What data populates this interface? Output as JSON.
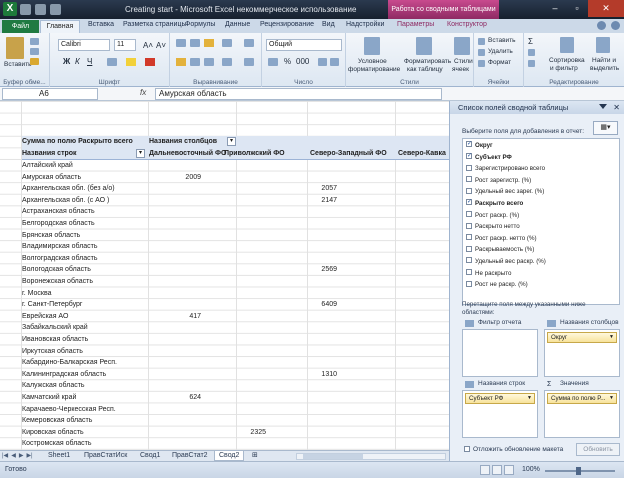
{
  "window": {
    "title": "Creating start  -  Microsoft Excel некоммерческое использование",
    "context_tab_group": "Работа со сводными таблицами",
    "app_icon_letter": "X"
  },
  "ribbon_tabs": {
    "file": "Файл",
    "active": "Главная",
    "items": [
      "Вставка",
      "Разметка страницы",
      "Формулы",
      "Данные",
      "Рецензирование",
      "Вид",
      "Надстройки"
    ],
    "context_items": [
      "Параметры",
      "Конструктор"
    ]
  },
  "ribbon": {
    "clipboard": {
      "group_label": "Буфер обме...",
      "paste_label": "Вставить"
    },
    "font": {
      "group_label": "Шрифт",
      "font_name": "Calibri",
      "font_size": "11",
      "bold": "Ж",
      "italic": "К",
      "underline": "Ч"
    },
    "alignment": {
      "group_label": "Выравнивание"
    },
    "number": {
      "group_label": "Число",
      "format": "Общий"
    },
    "styles": {
      "group_label": "Стили",
      "conditional": [
        "Условное",
        "форматирование"
      ],
      "format_table": [
        "Форматировать",
        "как таблицу"
      ],
      "cell_styles": [
        "Стили",
        "ячеек"
      ]
    },
    "cells": {
      "group_label": "Ячейки",
      "insert": "Вставить",
      "delete": "Удалить",
      "format": "Формат"
    },
    "editing": {
      "group_label": "Редактирование",
      "sort": [
        "Сортировка",
        "и фильтр"
      ],
      "find": [
        "Найти и",
        "выделить"
      ]
    }
  },
  "formula_bar": {
    "name_box": "A6",
    "fx": "fx",
    "value": "Амурская область"
  },
  "pivot": {
    "value_field": "Сумма по полю Раскрыто всего",
    "columns_label": "Названия столбцов",
    "rows_label": "Названия строк",
    "columns": [
      "Дальневосточный ФО",
      "Приволжский ФО",
      "Северо-Западный ФО",
      "Северо-Кавка"
    ],
    "rows": [
      {
        "name": "Алтайский край",
        "values": [
          "",
          "",
          "",
          ""
        ]
      },
      {
        "name": "Амурская область",
        "values": [
          "2009",
          "",
          "",
          ""
        ]
      },
      {
        "name": "Архангельская обл. (без а/о)",
        "values": [
          "",
          "",
          "2057",
          ""
        ]
      },
      {
        "name": "Архангельская обл. (с АО )",
        "values": [
          "",
          "",
          "2147",
          ""
        ]
      },
      {
        "name": "Астраханская область",
        "values": [
          "",
          "",
          "",
          ""
        ]
      },
      {
        "name": "Белгородская область",
        "values": [
          "",
          "",
          "",
          ""
        ]
      },
      {
        "name": "Брянская область",
        "values": [
          "",
          "",
          "",
          ""
        ]
      },
      {
        "name": "Владимирская область",
        "values": [
          "",
          "",
          "",
          ""
        ]
      },
      {
        "name": "Волгоградская область",
        "values": [
          "",
          "",
          "",
          ""
        ]
      },
      {
        "name": "Вологодская область",
        "values": [
          "",
          "",
          "2569",
          ""
        ]
      },
      {
        "name": "Воронежская область",
        "values": [
          "",
          "",
          "",
          ""
        ]
      },
      {
        "name": "г. Москва",
        "values": [
          "",
          "",
          "",
          ""
        ]
      },
      {
        "name": "г. Санкт-Петербург",
        "values": [
          "",
          "",
          "6409",
          ""
        ]
      },
      {
        "name": "Еврейская АО",
        "values": [
          "417",
          "",
          "",
          ""
        ]
      },
      {
        "name": "Забайкальский край",
        "values": [
          "",
          "",
          "",
          ""
        ]
      },
      {
        "name": "Ивановская область",
        "values": [
          "",
          "",
          "",
          ""
        ]
      },
      {
        "name": "Иркутская область",
        "values": [
          "",
          "",
          "",
          ""
        ]
      },
      {
        "name": "Кабардино-Балкарская Респ.",
        "values": [
          "",
          "",
          "",
          ""
        ]
      },
      {
        "name": "Калининградская область",
        "values": [
          "",
          "",
          "1310",
          ""
        ]
      },
      {
        "name": "Калужская область",
        "values": [
          "",
          "",
          "",
          ""
        ]
      },
      {
        "name": "Камчатский край",
        "values": [
          "624",
          "",
          "",
          ""
        ]
      },
      {
        "name": "Карачаево-Черкесская Респ.",
        "values": [
          "",
          "",
          "",
          ""
        ]
      },
      {
        "name": "Кемеровская область",
        "values": [
          "",
          "",
          "",
          ""
        ]
      },
      {
        "name": "Кировская область",
        "values": [
          "",
          "2325",
          "",
          ""
        ]
      },
      {
        "name": "Костромская область",
        "values": [
          "",
          "",
          "",
          ""
        ]
      }
    ]
  },
  "sheet_tabs": {
    "items": [
      "Sheet1",
      "ПравСтатИск",
      "Свод1",
      "ПравСтат2",
      "Свод2"
    ],
    "active": "Свод2"
  },
  "status": {
    "ready": "Готово",
    "zoom": "100%"
  },
  "field_list": {
    "title": "Список полей сводной таблицы",
    "prompt": "Выберите поля для добавления в отчет:",
    "fields": [
      {
        "label": "Округ",
        "checked": true
      },
      {
        "label": "Субъект РФ",
        "checked": true
      },
      {
        "label": "Зарегистрировано всего",
        "checked": false
      },
      {
        "label": "Рост зарегистр. (%)",
        "checked": false
      },
      {
        "label": "Удельный вес зарег. (%)",
        "checked": false
      },
      {
        "label": "Раскрыто всего",
        "checked": true
      },
      {
        "label": "Рост раскр. (%)",
        "checked": false
      },
      {
        "label": "Раскрыто нетто",
        "checked": false
      },
      {
        "label": "Рост раскр. нетто (%)",
        "checked": false
      },
      {
        "label": "Раскрываемость (%)",
        "checked": false
      },
      {
        "label": "Удельный вес раскр. (%)",
        "checked": false
      },
      {
        "label": "Не раскрыто",
        "checked": false
      },
      {
        "label": "Рост не раскр. (%)",
        "checked": false
      }
    ],
    "drag_hint": "Перетащите поля между указанными ниже областями:",
    "zones": {
      "filter": {
        "label": "Фильтр отчета",
        "items": []
      },
      "columns": {
        "label": "Названия столбцов",
        "items": [
          "Округ"
        ]
      },
      "rows": {
        "label": "Названия строк",
        "items": [
          "Субъект РФ"
        ]
      },
      "values": {
        "label": "Значения",
        "items": [
          "Сумма по полю Р..."
        ]
      }
    },
    "defer_label": "Отложить обновление макета",
    "update_button": "Обновить"
  }
}
